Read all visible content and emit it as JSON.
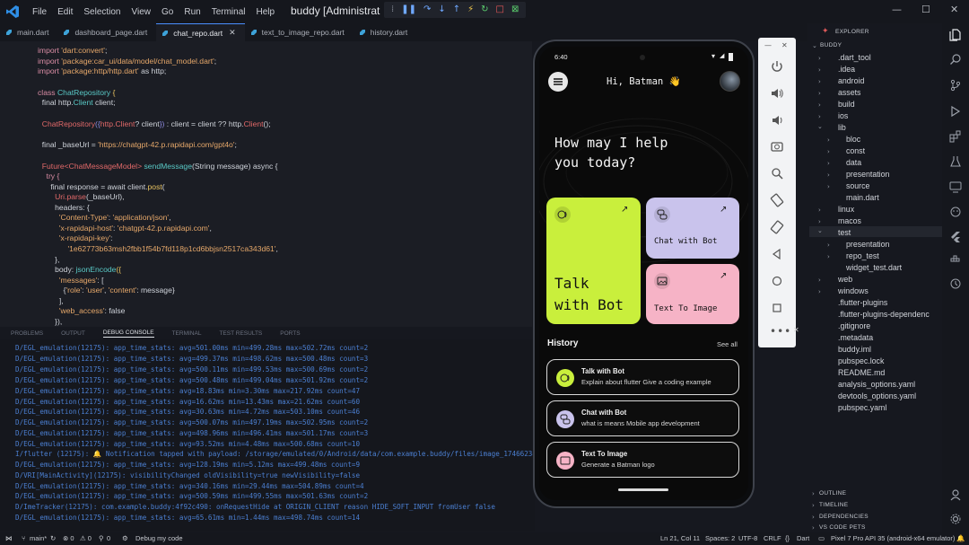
{
  "menu": [
    "File",
    "Edit",
    "Selection",
    "View",
    "Go",
    "Run",
    "Terminal",
    "Help"
  ],
  "window_title": "buddy [Administrat",
  "tabs": [
    {
      "label": "main.dart"
    },
    {
      "label": "dashboard_page.dart"
    },
    {
      "label": "chat_repo.dart"
    },
    {
      "label": "text_to_image_repo.dart"
    },
    {
      "label": "history.dart"
    }
  ],
  "code": {
    "l1a": "import ",
    "l1b": "'dart:convert'",
    "l1c": ";",
    "l2a": "import ",
    "l2b": "'package:car_ui/data/model/chat_model.dart'",
    "l2c": ";",
    "l3a": "import ",
    "l3b": "'package:http/http.dart'",
    "l3c": " as http;",
    "l5a": "class ",
    "l5b": "ChatRepository",
    "l5c": " {",
    "l6a": "  final http.",
    "l6b": "Client",
    "l6c": " client;",
    "l8a": "  ChatRepository",
    "l8b": "({",
    "l8c": "http.Client",
    "l8d": "? client",
    "l8e": "})",
    "l8f": " : client = client ?? http.",
    "l8g": "Client",
    "l8h": "();",
    "l10a": "  final _baseUrl = ",
    "l10b": "'https://chatgpt-42.p.rapidapi.com/gpt4o'",
    "l10c": ";",
    "l12a": "  Future",
    "l12b": "<ChatMessageModel>",
    "l12c": " sendMessage",
    "l12d": "(String message) async {",
    "l13": "    try {",
    "l14a": "      final response = await client.",
    "l14b": "post",
    "l14c": "(",
    "l15a": "        Uri",
    "l15b": ".parse",
    "l15c": "(_baseUrl),",
    "l16": "        headers: {",
    "l17a": "          ",
    "l17b": "'Content-Type'",
    "l17c": ": ",
    "l17d": "'application/json'",
    "l17e": ",",
    "l18a": "          ",
    "l18b": "'x-rapidapi-host'",
    "l18c": ": ",
    "l18d": "'chatgpt-42.p.rapidapi.com'",
    "l18e": ",",
    "l19a": "          ",
    "l19b": "'x-rapidapi-key'",
    "l19c": ":",
    "l20a": "              ",
    "l20b": "'1e62773b63msh2fbb1f54b7fd118p1cd6bbjsn2517ca343d61'",
    "l20c": ",",
    "l21": "        },",
    "l22a": "        body: ",
    "l22b": "jsonEncode",
    "l22c": "({",
    "l23a": "          ",
    "l23b": "'messages'",
    "l23c": ": [",
    "l24a": "            {",
    "l24b": "'role'",
    "l24c": ": ",
    "l24d": "'user'",
    "l24e": ", ",
    "l24f": "'content'",
    "l24g": ": message}",
    "l25": "          ],",
    "l26a": "          ",
    "l26b": "'web_access'",
    "l26c": ": false",
    "l27": "        }),"
  },
  "panel_tabs": [
    "PROBLEMS",
    "OUTPUT",
    "DEBUG CONSOLE",
    "TERMINAL",
    "TEST RESULTS",
    "PORTS"
  ],
  "logs": [
    "D/EGL_emulation(12175): app_time_stats: avg=501.00ms min=499.28ms max=502.72ms count=2",
    "D/EGL_emulation(12175): app_time_stats: avg=499.37ms min=498.62ms max=500.48ms count=3",
    "D/EGL_emulation(12175): app_time_stats: avg=500.11ms min=499.53ms max=500.69ms count=2",
    "D/EGL_emulation(12175): app_time_stats: avg=500.48ms min=499.04ms max=501.92ms count=2",
    "D/EGL_emulation(12175): app_time_stats: avg=18.83ms min=3.30ms max=217.92ms count=47",
    "D/EGL_emulation(12175): app_time_stats: avg=16.62ms min=13.43ms max=21.62ms count=60",
    "D/EGL_emulation(12175): app_time_stats: avg=30.63ms min=4.72ms max=503.10ms count=46",
    "D/EGL_emulation(12175): app_time_stats: avg=500.07ms min=497.19ms max=502.95ms count=2",
    "D/EGL_emulation(12175): app_time_stats: avg=498.96ms min=496.41ms max=501.17ms count=3",
    "D/EGL_emulation(12175): app_time_stats: avg=93.52ms min=4.48ms max=500.68ms count=10",
    "I/flutter (12175): 🔔 Notification tapped with payload: /storage/emulated/0/Android/data/com.example.buddy/files/image_17466234",
    "D/EGL_emulation(12175): app_time_stats: avg=128.19ms min=5.12ms max=499.48ms count=9",
    "D/VRI[MainActivity](12175): visibilityChanged oldVisibility=true newVisibility=false",
    "D/EGL_emulation(12175): app_time_stats: avg=340.16ms min=29.44ms max=504.89ms count=4",
    "D/EGL_emulation(12175): app_time_stats: avg=500.59ms min=499.55ms max=501.63ms count=2",
    "D/ImeTracker(12175): com.example.buddy:4f92c490: onRequestHide at ORIGIN_CLIENT reason HIDE_SOFT_INPUT fromUser false",
    "D/EGL_emulation(12175): app_time_stats: avg=65.61ms min=1.44ms max=498.74ms count=14"
  ],
  "phone": {
    "time": "6:40",
    "greeting": "Hi, Batman 👋",
    "headline1": "How may I help",
    "headline2": "you today?",
    "card_talk1": "Talk",
    "card_talk2": "with Bot",
    "card_chat": "Chat with Bot",
    "card_image": "Text To Image",
    "history_title": "History",
    "see_all": "See all",
    "history": [
      {
        "title": "Talk with Bot",
        "sub": "Explain about flutter Give a coding example"
      },
      {
        "title": "Chat with Bot",
        "sub": "what is means Mobile app development"
      },
      {
        "title": "Text To Image",
        "sub": "Generate a Batman logo"
      }
    ]
  },
  "explorer": {
    "title": "EXPLORER",
    "root": "BUDDY",
    "items": [
      ".dart_tool",
      ".idea",
      "android",
      "assets",
      "build",
      "ios",
      "lib",
      "bloc",
      "const",
      "data",
      "presentation",
      "source",
      "main.dart",
      "linux",
      "macos",
      "test",
      "presentation",
      "repo_test",
      "widget_test.dart",
      "web",
      "windows",
      ".flutter-plugins",
      ".flutter-plugins-dependenc",
      ".gitignore",
      ".metadata",
      "buddy.iml",
      "pubspec.lock",
      "README.md",
      "analysis_options.yaml",
      "devtools_options.yaml",
      "pubspec.yaml"
    ],
    "sections": [
      "OUTLINE",
      "TIMELINE",
      "DEPENDENCIES",
      "VS CODE PETS"
    ]
  },
  "status": {
    "branch": "main*",
    "errors": "⊗ 0",
    "warnings": "⚠ 0",
    "ports": "0",
    "debug": "Debug my code",
    "position": "Ln 21, Col 11",
    "spaces": "Spaces: 2",
    "encoding": "UTF-8",
    "eol": "CRLF",
    "language": "Dart",
    "device": "Pixel 7 Pro API 35 (android-x64 emulator)"
  },
  "colors": {
    "accent": "#4a8fff",
    "lime": "#c9ef3c",
    "lavender": "#c9c3ec",
    "pink": "#f6b3c6"
  }
}
